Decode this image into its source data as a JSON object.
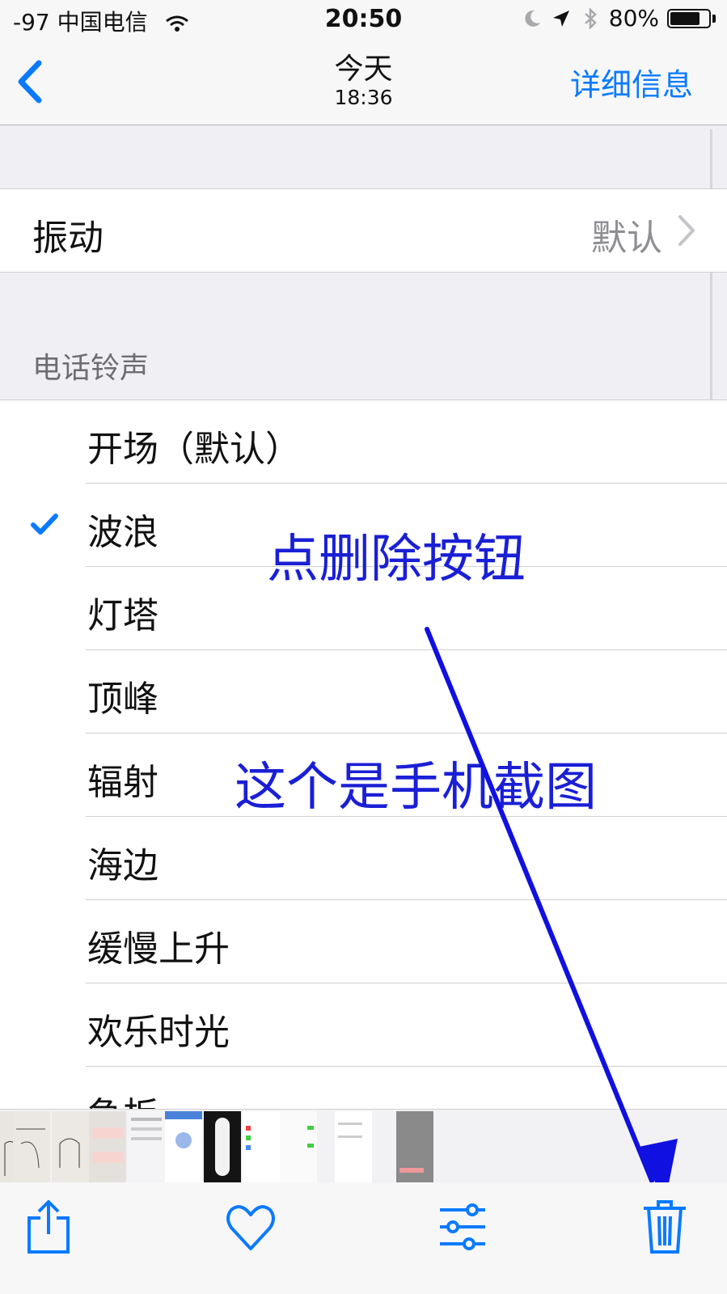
{
  "status_bar": {
    "signal_carrier": "-97 中国电信",
    "time": "20:50",
    "battery": "80%",
    "battery_level": 0.8
  },
  "nav": {
    "title": "今天",
    "subtitle": "18:36",
    "detail_label": "详细信息"
  },
  "vibration": {
    "label": "振动",
    "value": "默认"
  },
  "ringtones": {
    "header": "电话铃声",
    "items": [
      {
        "name": "开场（默认）",
        "checked": false
      },
      {
        "name": "波浪",
        "checked": true
      },
      {
        "name": "灯塔",
        "checked": false
      },
      {
        "name": "顶峰",
        "checked": false
      },
      {
        "name": "辐射",
        "checked": false
      },
      {
        "name": "海边",
        "checked": false
      },
      {
        "name": "缓慢上升",
        "checked": false
      },
      {
        "name": "欢乐时光",
        "checked": false
      },
      {
        "name": "急板",
        "checked": false
      }
    ]
  },
  "annotations": {
    "tap_delete": "点删除按钮",
    "is_screenshot": "这个是手机截图"
  },
  "toolbar": {
    "share_icon": "share-icon",
    "favorite_icon": "heart-icon",
    "adjust_icon": "sliders-icon",
    "delete_icon": "trash-icon"
  },
  "colors": {
    "accent": "#0a7aff",
    "annotation": "#1a1fd6"
  }
}
